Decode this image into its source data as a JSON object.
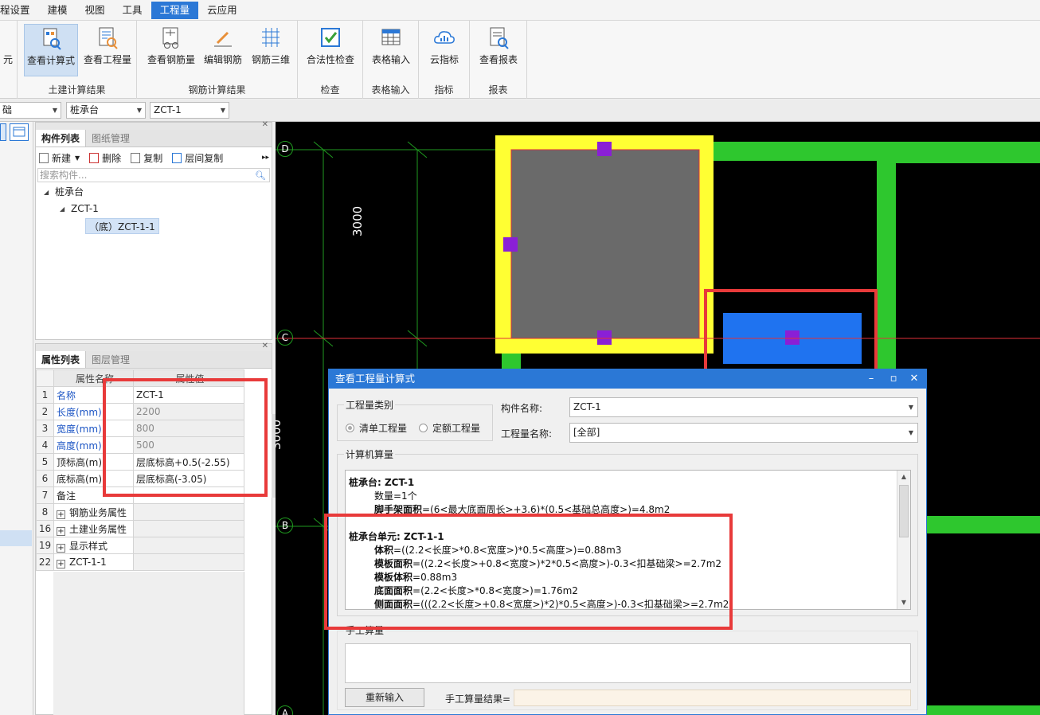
{
  "menu": {
    "items": [
      "程设置",
      "建模",
      "视图",
      "工具",
      "工程量",
      "云应用"
    ],
    "active_index": 4
  },
  "ribbon": {
    "partial_left": "元",
    "groups": [
      {
        "label": "土建计算结果",
        "buttons": [
          "查看计算式",
          "查看工程量"
        ]
      },
      {
        "label": "钢筋计算结果",
        "buttons": [
          "查看钢筋量",
          "编辑钢筋",
          "钢筋三维"
        ]
      },
      {
        "label": "检查",
        "buttons": [
          "合法性检查"
        ]
      },
      {
        "label": "表格输入",
        "buttons": [
          "表格输入"
        ]
      },
      {
        "label": "指标",
        "buttons": [
          "云指标"
        ]
      },
      {
        "label": "报表",
        "buttons": [
          "查看报表"
        ]
      }
    ]
  },
  "selectors": {
    "floor": "础",
    "type": "桩承台",
    "component": "ZCT-1"
  },
  "component_panel": {
    "tabs": [
      "构件列表",
      "图纸管理"
    ],
    "tools": [
      "新建",
      "删除",
      "复制",
      "层间复制"
    ],
    "search_placeholder": "搜索构件...",
    "tree": {
      "root": "桩承台",
      "child": "ZCT-1",
      "leaf": "（底）ZCT-1-1"
    }
  },
  "property_panel": {
    "tabs": [
      "属性列表",
      "图层管理"
    ],
    "headers": [
      "属性名称",
      "属性值"
    ],
    "rows": [
      {
        "n": "1",
        "k": "名称",
        "v": "ZCT-1"
      },
      {
        "n": "2",
        "k": "长度(mm)",
        "v": "2200"
      },
      {
        "n": "3",
        "k": "宽度(mm)",
        "v": "800"
      },
      {
        "n": "4",
        "k": "高度(mm)",
        "v": "500"
      },
      {
        "n": "5",
        "k": "顶标高(m)",
        "v": "层底标高+0.5(-2.55)"
      },
      {
        "n": "6",
        "k": "底标高(m)",
        "v": "层底标高(-3.05)"
      },
      {
        "n": "7",
        "k": "备注",
        "v": ""
      },
      {
        "n": "8",
        "k": "钢筋业务属性",
        "v": ""
      },
      {
        "n": "16",
        "k": "土建业务属性",
        "v": ""
      },
      {
        "n": "19",
        "k": "显示样式",
        "v": ""
      },
      {
        "n": "22",
        "k": "ZCT-1-1",
        "v": ""
      }
    ]
  },
  "canvas": {
    "axes": [
      "D",
      "C",
      "B",
      "A"
    ],
    "dim_top": "3000",
    "dim_mid": "3000"
  },
  "dialog": {
    "title": "查看工程量计算式",
    "category_label": "工程量类别",
    "radio1": "清单工程量",
    "radio2": "定额工程量",
    "component_name_label": "构件名称:",
    "component_name": "ZCT-1",
    "quantity_name_label": "工程量名称:",
    "quantity_name": "[全部]",
    "computer_calc_label": "计算机算量",
    "lines": [
      {
        "b": "桩承台: ZCT-1",
        "t": ""
      },
      {
        "b": "",
        "t": "数量=1个"
      },
      {
        "b": "脚手架面积",
        "t": "=(6<最大底面周长>+3.6)*(0.5<基础总高度>)=4.8m2"
      },
      {
        "b": "桩承台单元: ZCT-1-1",
        "t": ""
      },
      {
        "b": "体积",
        "t": "=((2.2<长度>*0.8<宽度>)*0.5<高度>)=0.88m3"
      },
      {
        "b": "模板面积",
        "t": "=((2.2<长度>+0.8<宽度>)*2*0.5<高度>)-0.3<扣基础梁>=2.7m2"
      },
      {
        "b": "模板体积",
        "t": "=0.88m3"
      },
      {
        "b": "底面面积",
        "t": "=(2.2<长度>*0.8<宽度>)=1.76m2"
      },
      {
        "b": "侧面面积",
        "t": "=(((2.2<长度>+0.8<宽度>)*2)*0.5<高度>)-0.3<扣基础梁>=2.7m2"
      }
    ],
    "manual_calc_label": "手工算量",
    "reenter_button": "重新输入",
    "manual_result_label": "手工算量结果="
  }
}
